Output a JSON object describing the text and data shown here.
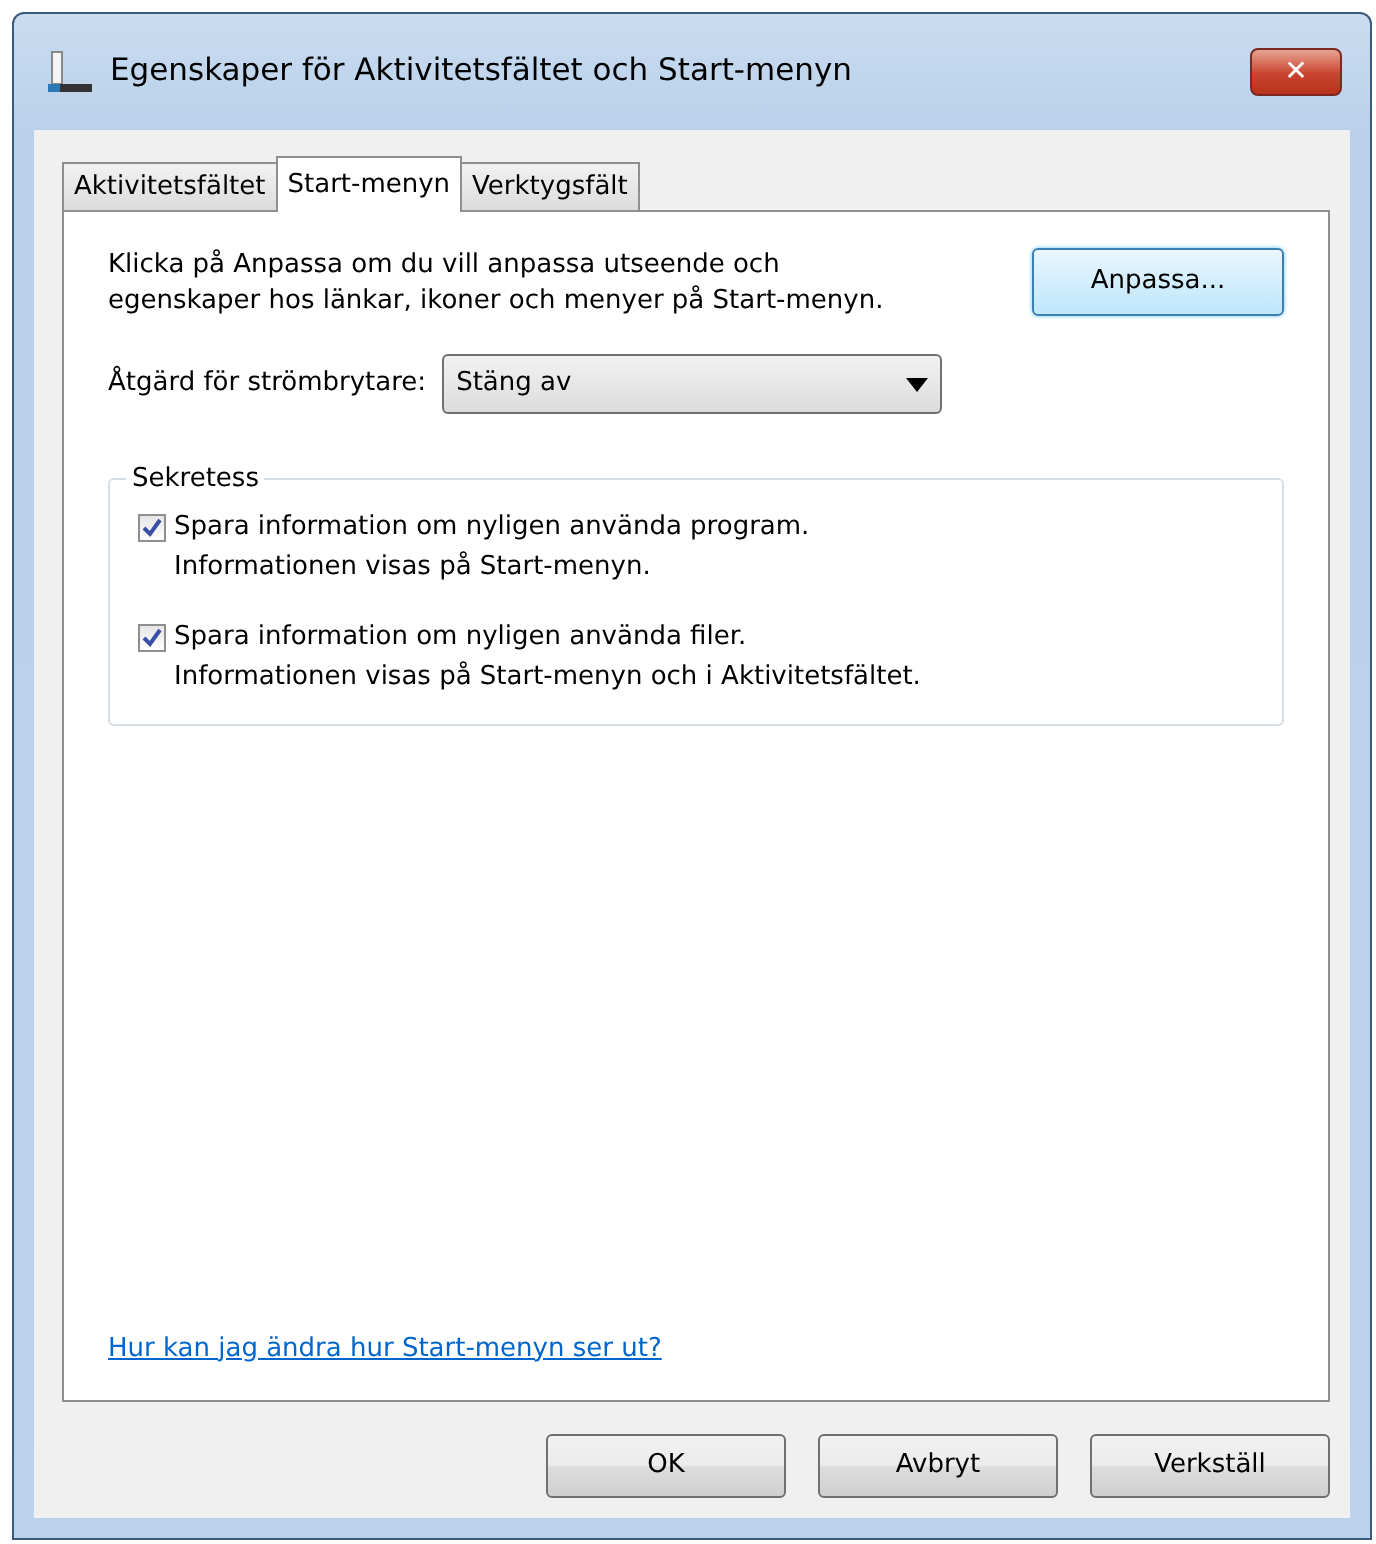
{
  "window": {
    "title": "Egenskaper för Aktivitetsfältet och Start-menyn",
    "close_label": "✕"
  },
  "tabs": [
    {
      "label": "Aktivitetsfältet",
      "selected": false
    },
    {
      "label": "Start-menyn",
      "selected": true
    },
    {
      "label": "Verktygsfält",
      "selected": false
    }
  ],
  "intro": "Klicka på Anpassa om du vill anpassa utseende och egenskaper hos länkar, ikoner och menyer på Start-menyn.",
  "customize_button": "Anpassa...",
  "power_button": {
    "label": "Åtgärd för strömbrytare:",
    "value": "Stäng av"
  },
  "privacy": {
    "title": "Sekretess",
    "options": [
      {
        "label": "Spara information om nyligen använda program.",
        "note": "Informationen visas på Start-menyn.",
        "checked": true
      },
      {
        "label": "Spara information om nyligen använda filer.",
        "note": "Informationen visas på Start-menyn och i Aktivitetsfältet.",
        "checked": true
      }
    ]
  },
  "help_link": "Hur kan jag ändra hur Start-menyn ser ut?",
  "buttons": [
    "OK",
    "Avbryt",
    "Verkställ"
  ]
}
